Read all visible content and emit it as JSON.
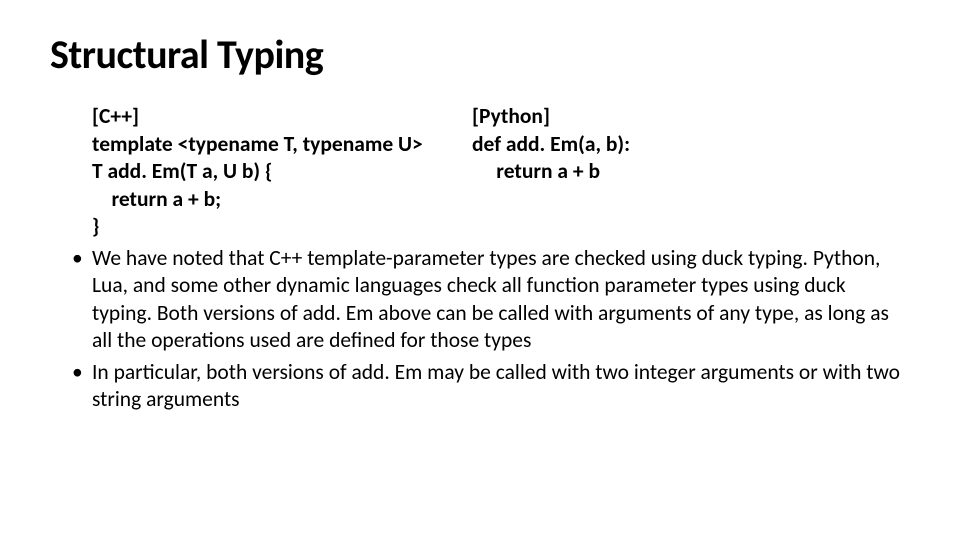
{
  "title": "Structural Typing",
  "code": {
    "left": {
      "header": "[C++]",
      "l1": "template <typename T, typename U>",
      "l2": "T add. Em(T a, U b) {",
      "l3": "    return a + b;",
      "l4": "}"
    },
    "right": {
      "header": "[Python]",
      "l1": "def add. Em(a, b):",
      "l2": "     return a + b"
    }
  },
  "bullets": {
    "b1": "We have noted that C++ template-parameter types are checked using duck typing.  Python, Lua, and some other dynamic languages check all function parameter types using duck typing. Both versions of add. Em above can be called with arguments of any type, as long as all the operations used are defined for those types",
    "b2": "In particular, both versions of add. Em may be called with two integer arguments or with two string arguments"
  }
}
